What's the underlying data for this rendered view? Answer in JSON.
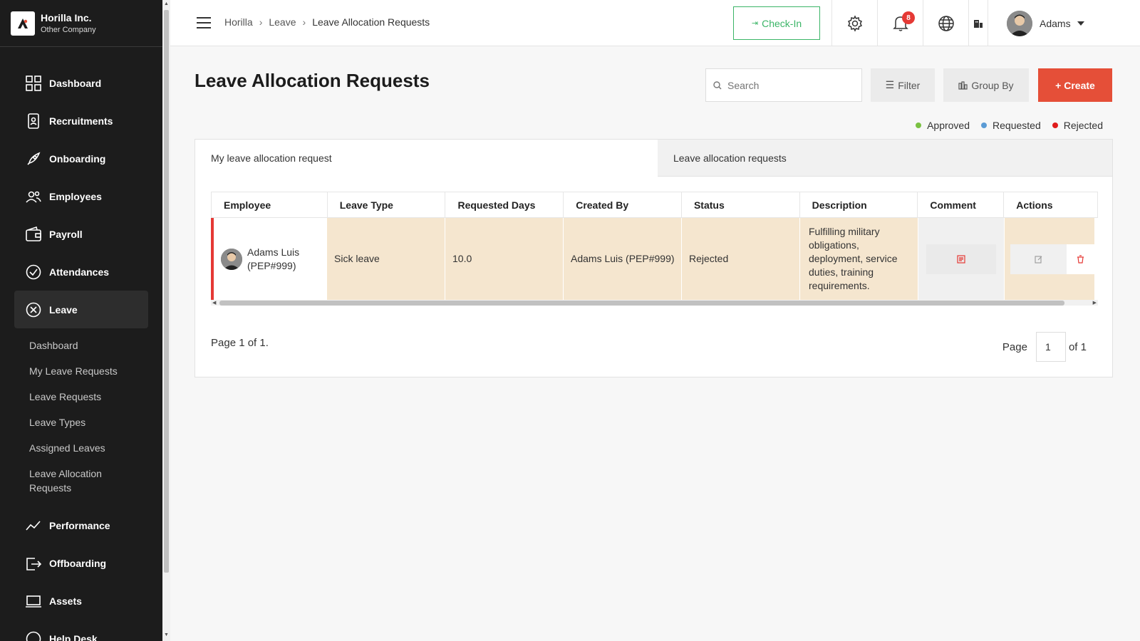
{
  "brand": {
    "name": "Horilla Inc.",
    "company": "Other Company"
  },
  "sidebar": {
    "items": [
      {
        "label": "Dashboard",
        "icon": "dashboard-icon"
      },
      {
        "label": "Recruitments",
        "icon": "recruitment-icon"
      },
      {
        "label": "Onboarding",
        "icon": "rocket-icon"
      },
      {
        "label": "Employees",
        "icon": "users-icon"
      },
      {
        "label": "Payroll",
        "icon": "wallet-icon"
      },
      {
        "label": "Attendances",
        "icon": "check-circle-icon"
      },
      {
        "label": "Leave",
        "icon": "x-circle-icon"
      }
    ],
    "leave_sub": [
      "Dashboard",
      "My Leave Requests",
      "Leave Requests",
      "Leave Types",
      "Assigned Leaves",
      "Leave Allocation Requests"
    ],
    "items_after": [
      {
        "label": "Performance",
        "icon": "chart-line-icon"
      },
      {
        "label": "Offboarding",
        "icon": "exit-icon"
      },
      {
        "label": "Assets",
        "icon": "laptop-icon"
      },
      {
        "label": "Help Desk",
        "icon": "help-icon"
      }
    ]
  },
  "header": {
    "breadcrumbs": [
      "Horilla",
      "Leave",
      "Leave Allocation Requests"
    ],
    "checkin_label": "Check-In",
    "notification_count": "8",
    "user_name": "Adams"
  },
  "page": {
    "title": "Leave Allocation Requests",
    "search_placeholder": "Search",
    "filter_label": "Filter",
    "groupby_label": "Group By",
    "create_label": "+ Create",
    "legend": [
      {
        "label": "Approved",
        "color": "#7ac142"
      },
      {
        "label": "Requested",
        "color": "#5b9bd5"
      },
      {
        "label": "Rejected",
        "color": "#e01b1b"
      }
    ],
    "tabs": [
      "My leave allocation request",
      "Leave allocation requests"
    ],
    "columns": [
      "Employee",
      "Leave Type",
      "Requested Days",
      "Created By",
      "Status",
      "Description",
      "Comment",
      "Actions"
    ],
    "row": {
      "employee": "Adams Luis (PEP#999)",
      "leave_type": "Sick leave",
      "requested_days": "10.0",
      "created_by": "Adams Luis (PEP#999)",
      "status": "Rejected",
      "description": "Fulfilling military obligations, deployment, service duties, training requirements."
    },
    "page_info": "Page 1 of 1.",
    "pager_label": "Page",
    "pager_value": "1",
    "pager_total": "of 1"
  },
  "colors": {
    "accent": "#e54f38",
    "checkin": "#3bb567",
    "rejected_border": "#e53935",
    "row_bg": "#f5e6cf"
  }
}
